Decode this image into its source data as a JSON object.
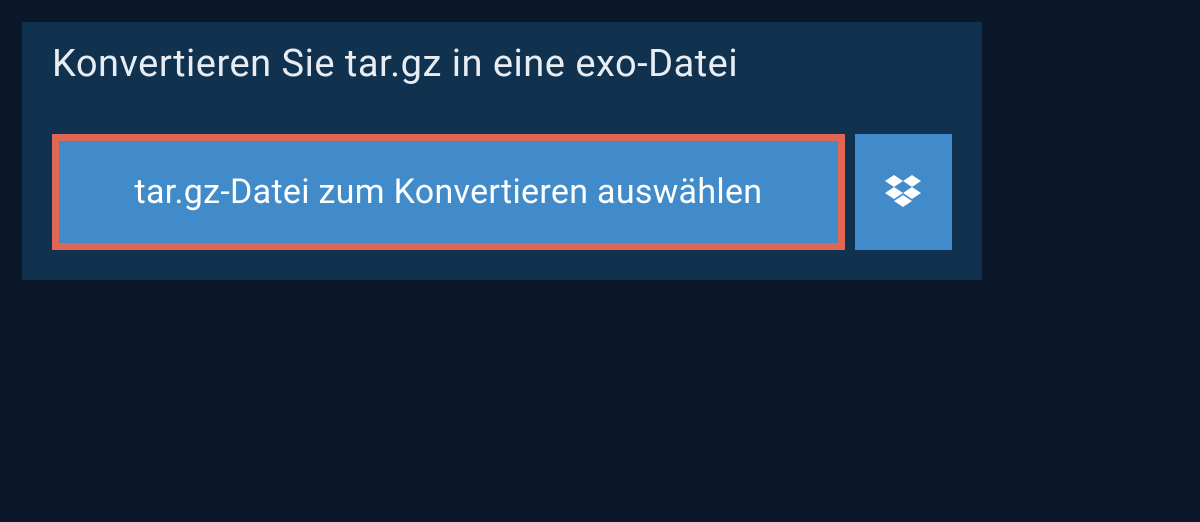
{
  "header": {
    "title": "Konvertieren Sie tar.gz in eine exo-Datei"
  },
  "actions": {
    "select_file_label": "tar.gz-Datei zum Konvertieren auswählen",
    "dropbox_icon": "dropbox-icon"
  },
  "colors": {
    "page_bg": "#0a1829",
    "card_bg": "#11324f",
    "button_bg": "#428bca",
    "highlight_border": "#e06656",
    "text_light": "#ffffff"
  }
}
